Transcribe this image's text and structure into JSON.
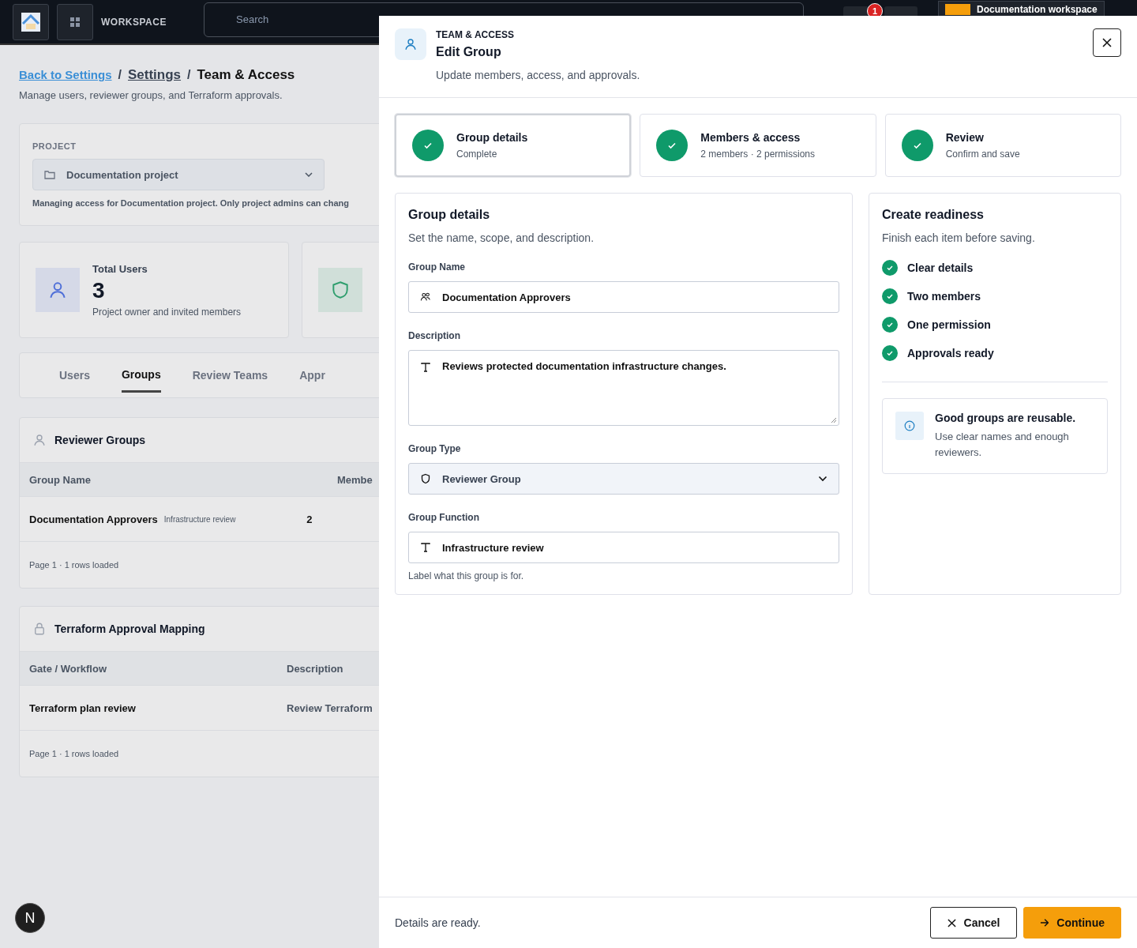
{
  "background": {
    "topbar": {
      "workspace_label": "WORKSPACE",
      "search": {
        "placeholder": "Search"
      },
      "notification_count": "1",
      "workspace_name": "Documentation workspace"
    },
    "breadcrumb": [
      {
        "label": "Back to Settings",
        "kind": "link"
      },
      {
        "label": "/",
        "kind": "separator"
      },
      {
        "label": "Settings",
        "kind": "crumb"
      },
      {
        "label": "/",
        "kind": "separator"
      },
      {
        "label": "Team & Access",
        "kind": "current"
      }
    ],
    "subtitle": "Manage users, reviewer groups, and Terraform approvals.",
    "project": {
      "label": "PROJECT",
      "value": "Documentation project",
      "note": "Managing access for Documentation project. Only project admins can chang"
    },
    "stats": [
      {
        "title": "Total Users",
        "value": "3",
        "caption": "Project owner and invited members",
        "color": "#4f6fd8"
      },
      {
        "color": "#2f9e6e"
      }
    ],
    "tabs": [
      {
        "label": "Users",
        "selected": false
      },
      {
        "label": "Groups",
        "selected": true
      },
      {
        "label": "Review Teams",
        "selected": false
      },
      {
        "label": "Appr",
        "selected": false
      }
    ],
    "tables": [
      {
        "title": "Reviewer Groups",
        "columns": [
          "Group Name",
          "Membe"
        ],
        "rows": [
          {
            "cells": [
              "Documentation Approvers",
              "2"
            ],
            "tag": "Infrastructure review"
          }
        ],
        "footer": "Page 1 · 1 rows loaded"
      },
      {
        "title": "Terraform Approval Mapping",
        "columns": [
          "Gate / Workflow",
          "Description"
        ],
        "rows": [
          {
            "cells": [
              "Terraform plan review",
              "Review Terraform"
            ]
          }
        ],
        "footer": "Page 1 · 1 rows loaded"
      }
    ],
    "assistant_badge": "N"
  },
  "drawer": {
    "eyebrow": "TEAM & ACCESS",
    "title": "Edit Group",
    "subtitle": "Update members, access, and approvals.",
    "steps": [
      {
        "title": "Group details",
        "caption": "Complete",
        "done": true,
        "selected": true
      },
      {
        "title": "Members & access",
        "caption": "2 members · 2 permissions",
        "done": true,
        "selected": false
      },
      {
        "title": "Review",
        "caption": "Confirm and save",
        "done": true,
        "selected": false
      }
    ],
    "form": {
      "title": "Group details",
      "subtitle": "Set the name, scope, and description.",
      "fields": [
        {
          "label": "Group Name",
          "kind": "text",
          "value": "Documentation Approvers"
        },
        {
          "label": "Description",
          "kind": "textarea",
          "value": "Reviews protected documentation infrastructure changes."
        },
        {
          "label": "Group Type",
          "kind": "select",
          "value": "Reviewer Group"
        },
        {
          "label": "Group Function",
          "kind": "text",
          "value": "Infrastructure review",
          "hint": "Label what this group is for."
        }
      ]
    },
    "readiness": {
      "title": "Create readiness",
      "subtitle": "Finish each item before saving.",
      "items": [
        {
          "label": "Clear details",
          "done": true
        },
        {
          "label": "Two members",
          "done": true
        },
        {
          "label": "One permission",
          "done": true
        },
        {
          "label": "Approvals ready",
          "done": true
        }
      ],
      "tip": {
        "title": "Good groups are reusable.",
        "text": "Use clear names and enough reviewers."
      }
    },
    "footer": {
      "status": "Details are ready.",
      "buttons": [
        {
          "label": "Cancel",
          "kind": "secondary"
        },
        {
          "label": "Continue",
          "kind": "primary"
        }
      ]
    }
  }
}
